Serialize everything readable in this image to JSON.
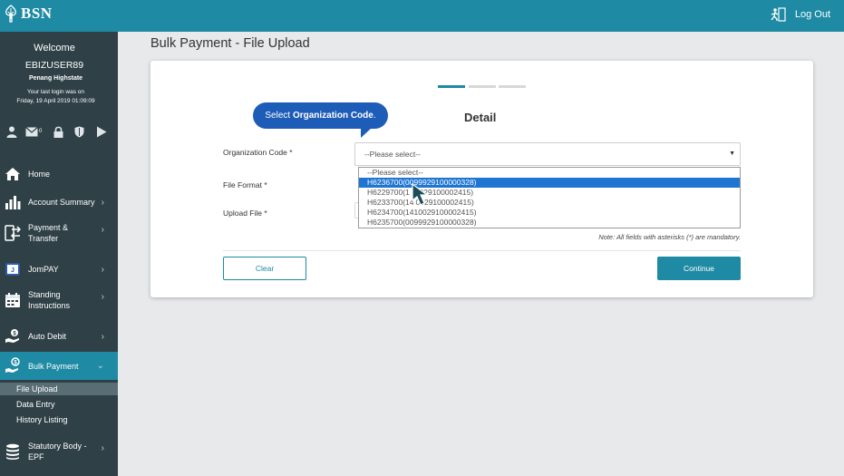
{
  "header": {
    "brand": "BSN",
    "logout_label": "Log Out"
  },
  "sidebar": {
    "welcome": "Welcome",
    "username": "EBIZUSER89",
    "company": "Penang Highstate",
    "last_login_line1": "Your last login was on",
    "last_login_line2": "Friday, 19 April 2019 01:09:09",
    "mail_count": "0",
    "items": [
      {
        "label": "Home"
      },
      {
        "label": "Account Summary"
      },
      {
        "label_line1": "Payment &",
        "label_line2": "Transfer"
      },
      {
        "label": "JomPAY"
      },
      {
        "label_line1": "Standing",
        "label_line2": "Instructions"
      },
      {
        "label": "Auto Debit"
      },
      {
        "label": "Bulk Payment"
      },
      {
        "label_line1": "Statutory Body -",
        "label_line2": "EPF"
      }
    ],
    "sub_items": [
      "File Upload",
      "Data Entry",
      "History Listing"
    ]
  },
  "page": {
    "title": "Bulk Payment - File Upload",
    "section_title": "Detail",
    "tooltip_prefix": "Select ",
    "tooltip_bold": "Organization Code",
    "tooltip_suffix": ".",
    "fields": {
      "org_code_label": "Organization Code *",
      "file_format_label": "File Format *",
      "upload_file_label": "Upload File *"
    },
    "select_value": "--Please select--",
    "options": [
      "--Please select--",
      "H6236700(0099929100000328)",
      "H6229700(1410029100002415)",
      "H6233700(1410029100002415)",
      "H6234700(1410029100002415)",
      "H6235700(0099929100000328)"
    ],
    "option_visible_3": "H6229700(1",
    "option_visible_3b": "0029100002415)",
    "option_visible_4": "H6233700(14",
    "option_visible_4b": "0029100002415)",
    "note": "Note: All fields with asterisks (*) are mandatory.",
    "clear_label": "Clear",
    "continue_label": "Continue"
  },
  "colors": {
    "brand": "#1e8aa3",
    "sidebar_bg": "#2f4047",
    "tooltip_bg": "#1e5db7",
    "selected_option": "#1f76d2"
  }
}
